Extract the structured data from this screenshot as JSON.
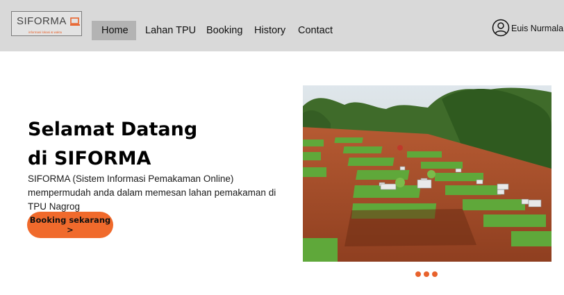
{
  "brand": {
    "name": "SIFORMA",
    "tagline": "informasi lokasi & waktu",
    "accent_color": "#e8622c"
  },
  "nav": {
    "items": [
      {
        "label": "Home",
        "active": true
      },
      {
        "label": "Lahan TPU",
        "active": false
      },
      {
        "label": "Booking",
        "active": false
      },
      {
        "label": "History",
        "active": false
      },
      {
        "label": "Contact",
        "active": false
      }
    ]
  },
  "user": {
    "name": "Euis Nurmala",
    "icon": "user-circle-icon"
  },
  "hero": {
    "title_line1": "Selamat Datang",
    "title_line2": "di SIFORMA",
    "description": "SIFORMA (Sistem Informasi Pemakaman Online) mempermudah anda dalam  memesan lahan pemakaman di TPU Nagrog",
    "cta_label": "Booking sekarang >",
    "cta_color": "#f06a2c"
  },
  "carousel": {
    "slide_count": 3,
    "active_index": 0
  }
}
